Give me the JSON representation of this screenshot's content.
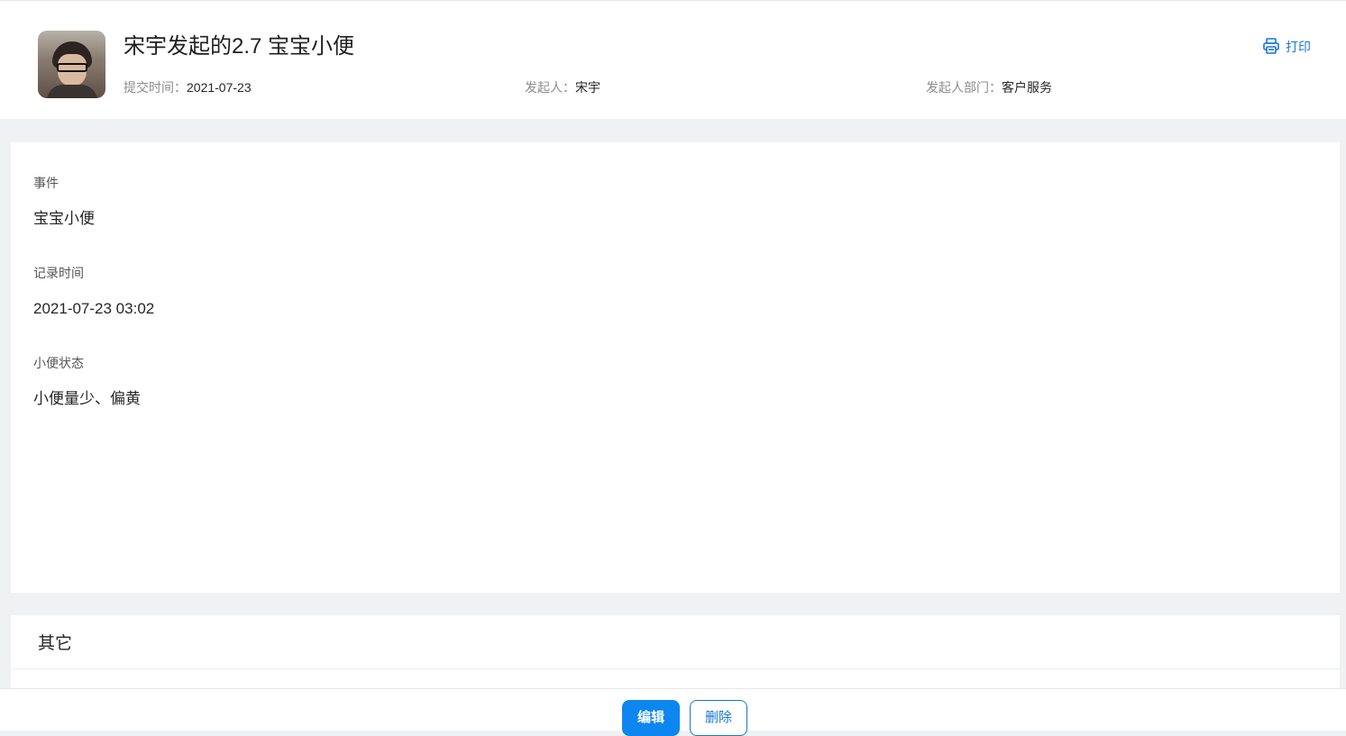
{
  "header": {
    "title": "宋宇发起的2.7 宝宝小便",
    "meta": [
      {
        "label": "提交时间：",
        "value": "2021-07-23"
      },
      {
        "label": "发起人：",
        "value": "宋宇"
      },
      {
        "label": "发起人部门：",
        "value": "客户服务"
      }
    ],
    "print_label": "打印"
  },
  "fields": [
    {
      "label": "事件",
      "value": "宝宝小便"
    },
    {
      "label": "记录时间",
      "value": "2021-07-23 03:02"
    },
    {
      "label": "小便状态",
      "value": "小便量少、偏黄"
    }
  ],
  "other": {
    "heading": "其它"
  },
  "footer": {
    "edit_label": "编辑",
    "delete_label": "删除"
  },
  "colors": {
    "accent": "#1677d2",
    "primary_button": "#0e86f0",
    "page_bg": "#f0f1f3"
  },
  "icons": {
    "print": "printer-icon"
  }
}
